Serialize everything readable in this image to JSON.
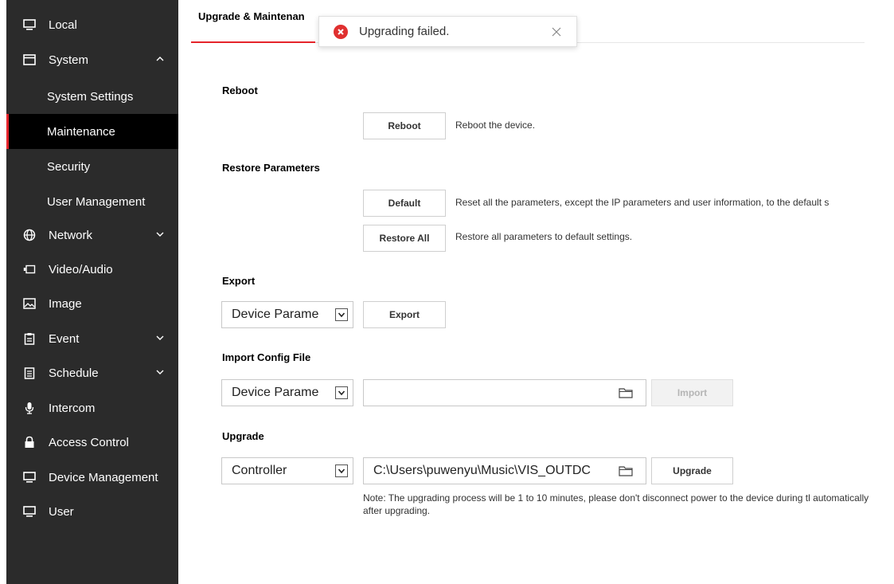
{
  "sidebar": {
    "items": [
      {
        "label": "Local",
        "icon": "monitor-icon"
      },
      {
        "label": "System",
        "icon": "window-icon"
      },
      {
        "label": "System Settings"
      },
      {
        "label": "Maintenance"
      },
      {
        "label": "Security"
      },
      {
        "label": "User Management"
      },
      {
        "label": "Network",
        "icon": "globe-icon"
      },
      {
        "label": "Video/Audio",
        "icon": "camera-icon"
      },
      {
        "label": "Image",
        "icon": "image-icon"
      },
      {
        "label": "Event",
        "icon": "clipboard-icon"
      },
      {
        "label": "Schedule",
        "icon": "calendar-icon"
      },
      {
        "label": "Intercom",
        "icon": "microphone-icon"
      },
      {
        "label": "Access Control",
        "icon": "lock-icon"
      },
      {
        "label": "Device Management",
        "icon": "monitor-icon"
      },
      {
        "label": "User",
        "icon": "monitor-icon"
      }
    ],
    "active_color": "#e5242b",
    "bg_color": "#2b2b2b"
  },
  "tab": {
    "label": "Upgrade & Maintenan"
  },
  "toast": {
    "message": "Upgrading failed.",
    "icon": "error-icon",
    "color": "#e0302f"
  },
  "reboot": {
    "title": "Reboot",
    "button": "Reboot",
    "desc": "Reboot the device."
  },
  "restore": {
    "title": "Restore Parameters",
    "default_button": "Default",
    "default_desc": "Reset all the parameters, except the IP parameters and user information, to the default s",
    "restore_all_button": "Restore All",
    "restore_all_desc": "Restore all parameters to default settings."
  },
  "export": {
    "title": "Export",
    "select_value": "Device Parame",
    "button": "Export"
  },
  "import": {
    "title": "Import Config File",
    "select_value": "Device Parame",
    "file_value": "",
    "button": "Import"
  },
  "upgrade": {
    "title": "Upgrade",
    "select_value": "Controller",
    "file_value": "C:\\Users\\puwenyu\\Music\\VIS_OUTDC",
    "button": "Upgrade",
    "note": "Note: The upgrading process will be 1 to 10 minutes, please don't disconnect power to the device during tl automatically after upgrading."
  }
}
